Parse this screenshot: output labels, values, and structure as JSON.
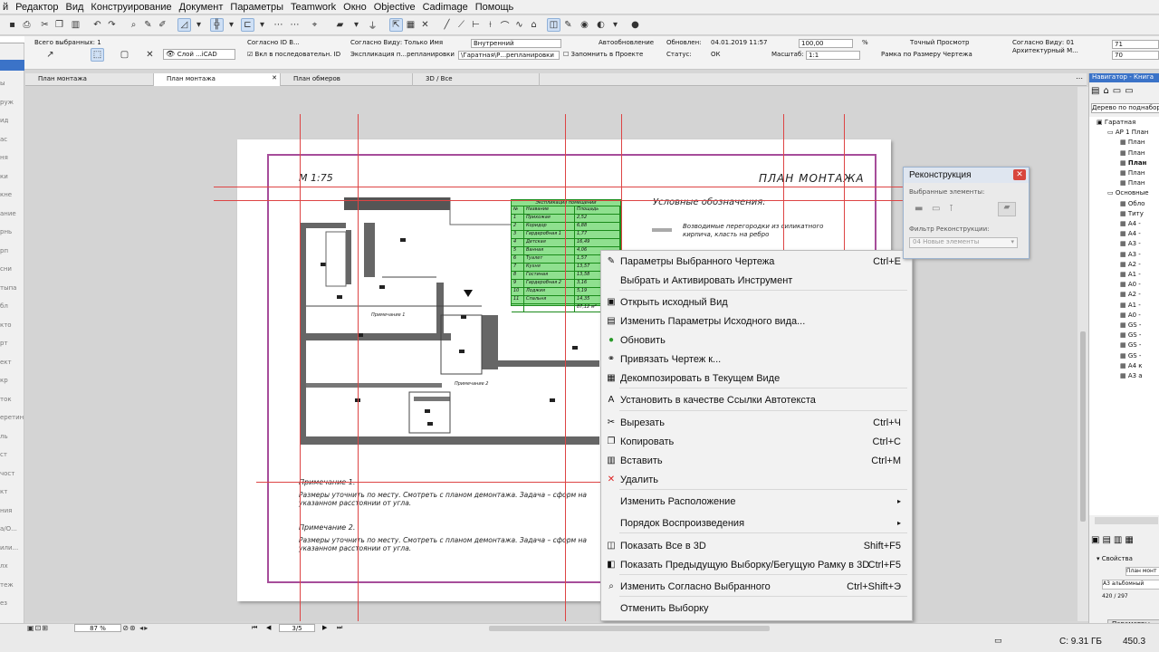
{
  "menu": [
    "й",
    "Редактор",
    "Вид",
    "Конструирование",
    "Документ",
    "Параметры",
    "Teamwork",
    "Окно",
    "Objective",
    "Cadimage",
    "Помощь"
  ],
  "infobox": {
    "selected_count": "Всего выбранных: 1",
    "layer": "Слой ...iCAD",
    "id_label": "Согласно ID В...",
    "sequence_label": "Вкл в последовательн. ID",
    "view_label": "Согласно Виду: Только Имя",
    "explication": "Экспликация п...репланировки",
    "internal": "Внутренний",
    "path": "\\Гаратная\\Р...репланировки",
    "remember": "Запомнить в Проекте",
    "autoupdate": "Автообновление",
    "status_label": "Статус:",
    "updated_label": "Обновлен:",
    "updated_value": "04.01.2019 11:57",
    "ok_value": "ОК",
    "percent_value": "100,00",
    "percent_sign": "%",
    "scale_label": "Масштаб:",
    "scale_value": "1:1",
    "exact_view": "Точный Просмотр",
    "frame_fit": "Рамка по Размеру Чертежа",
    "view_num": "Согласно Виду: 01",
    "arch": "Архитектурный М...",
    "field71": "71",
    "field70": "70"
  },
  "tabs": [
    {
      "label": "План монтажа",
      "active": false
    },
    {
      "label": "План монтажа",
      "active": true
    },
    {
      "label": "План обмеров",
      "active": false
    },
    {
      "label": "3D / Все",
      "active": false
    }
  ],
  "left_tools": [
    "ы",
    "руж",
    "ид",
    "ас",
    "ня",
    "ки",
    "кне",
    "ание",
    "рнь",
    "рп",
    "сни",
    "тыпа",
    "бл",
    "кто",
    "рт",
    "ект",
    "кр",
    "ток",
    "еретин",
    "ль",
    "ст",
    "чост",
    "кт",
    "ния",
    "а/О...",
    "или...",
    "лх",
    "теж",
    "ез"
  ],
  "drawing": {
    "scale": "М 1:75",
    "title": "ПЛАН МОНТАЖА",
    "legend_title": "Условные обозначения:",
    "legend_text": "Возводимые перегородки из силикатного кирпича, класть на ребро",
    "note1_title": "Примечание 1.",
    "note1_text": "Размеры уточнить по месту. Смотреть с планом демонтажа. Задача – сформ на указанном расстоянии от угла.",
    "note2_title": "Примечание 2.",
    "note2_text": "Размеры уточнить по месту. Смотреть с планом демонтажа. Задача – сформ на указанном расстоянии от угла.",
    "plan_note1": "Примечание 1",
    "plan_note2": "Примечание 2",
    "table_title": "Экспликация помещений",
    "table_headers": [
      "№",
      "Название",
      "Площадь"
    ],
    "table_rows": [
      [
        "1",
        "Прихожая",
        "2,52"
      ],
      [
        "2",
        "Коридор",
        "6,88"
      ],
      [
        "3",
        "Гардеробная 1",
        "1,77"
      ],
      [
        "4",
        "Детская",
        "16,49"
      ],
      [
        "5",
        "Ванная",
        "4,06"
      ],
      [
        "6",
        "Туалет",
        "1,57"
      ],
      [
        "7",
        "Кухня",
        "13,57"
      ],
      [
        "8",
        "Гостиная",
        "13,58"
      ],
      [
        "9",
        "Гардеробная 2",
        "3,16"
      ],
      [
        "10",
        "Лоджия",
        "5,19"
      ],
      [
        "11",
        "Спальня",
        "14,35"
      ],
      [
        "",
        "",
        "87,12 м²"
      ]
    ]
  },
  "context_menu": [
    {
      "label": "Параметры Выбранного Чертежа",
      "shortcut": "Ctrl+E",
      "icon": "drawing-settings-icon",
      "glyph": "✎"
    },
    {
      "label": "Выбрать и Активировать Инструмент",
      "shortcut": "",
      "icon": "",
      "glyph": ""
    },
    {
      "label": "Открыть исходный Вид",
      "shortcut": "",
      "icon": "open-view-icon",
      "glyph": "▣"
    },
    {
      "label": "Изменить Параметры Исходного вида...",
      "shortcut": "",
      "icon": "view-settings-icon",
      "glyph": "▤"
    },
    {
      "label": "Обновить",
      "shortcut": "",
      "icon": "refresh-icon",
      "glyph": "●"
    },
    {
      "label": "Привязать Чертеж к...",
      "shortcut": "",
      "icon": "link-icon",
      "glyph": "⚭"
    },
    {
      "label": "Декомпозировать в Текущем Виде",
      "shortcut": "",
      "icon": "decompose-icon",
      "glyph": "▦"
    },
    {
      "label": "Установить в качестве Ссылки Автотекста",
      "shortcut": "",
      "icon": "autotext-icon",
      "glyph": "A"
    },
    {
      "label": "Вырезать",
      "shortcut": "Ctrl+Ч",
      "icon": "cut-icon",
      "glyph": "✂"
    },
    {
      "label": "Копировать",
      "shortcut": "Ctrl+C",
      "icon": "copy-icon",
      "glyph": "❐"
    },
    {
      "label": "Вставить",
      "shortcut": "Ctrl+M",
      "icon": "paste-icon",
      "glyph": "▥"
    },
    {
      "label": "Удалить",
      "shortcut": "",
      "icon": "delete-icon",
      "glyph": "✕"
    },
    {
      "label": "Изменить Расположение",
      "shortcut": "",
      "icon": "",
      "glyph": "",
      "submenu": true
    },
    {
      "label": "Порядок Воспроизведения",
      "shortcut": "",
      "icon": "",
      "glyph": "",
      "submenu": true
    },
    {
      "label": "Показать Все в 3D",
      "shortcut": "Shift+F5",
      "icon": "3d-icon",
      "glyph": "◫"
    },
    {
      "label": "Показать Предыдущую Выборку/Бегущую Рамку в 3D",
      "shortcut": "Ctrl+F5",
      "icon": "3d-marquee-icon",
      "glyph": "◧"
    },
    {
      "label": "Изменить Согласно Выбранного",
      "shortcut": "Ctrl+Shift+Э",
      "icon": "eyedropper-icon",
      "glyph": "⌕"
    },
    {
      "label": "Отменить Выборку",
      "shortcut": "",
      "icon": "",
      "glyph": ""
    }
  ],
  "recon": {
    "title": "Реконструкция",
    "selected_label": "Выбранные элементы:",
    "filter_label": "Фильтр Реконструкции:",
    "filter_value": "04 Новые элементы"
  },
  "navigator": {
    "title": "Навигатор - Книга",
    "dropdown": "Дерево по поднабор",
    "tree": [
      "Гаратная",
      "АР 1 План",
      "План",
      "План",
      "План",
      "План",
      "План",
      "Основные",
      "Обло",
      "Титу",
      "А4 -",
      "А4 -",
      "А3 -",
      "А3 -",
      "А2 -",
      "А1 -",
      "А0 -",
      "А2 -",
      "А1 -",
      "А0 -",
      "GS -",
      "GS -",
      "GS -",
      "GS -",
      "А4 к",
      "А3 а"
    ],
    "props_label": "Свойства",
    "prop_value": "План монт",
    "format": "А3 альбомный",
    "size": "420 / 297",
    "params_btn": "Параметры"
  },
  "status": {
    "zoom": "87 %",
    "page": "3/5",
    "disk": "С: 9.31 ГБ",
    "mem": "450.3"
  }
}
